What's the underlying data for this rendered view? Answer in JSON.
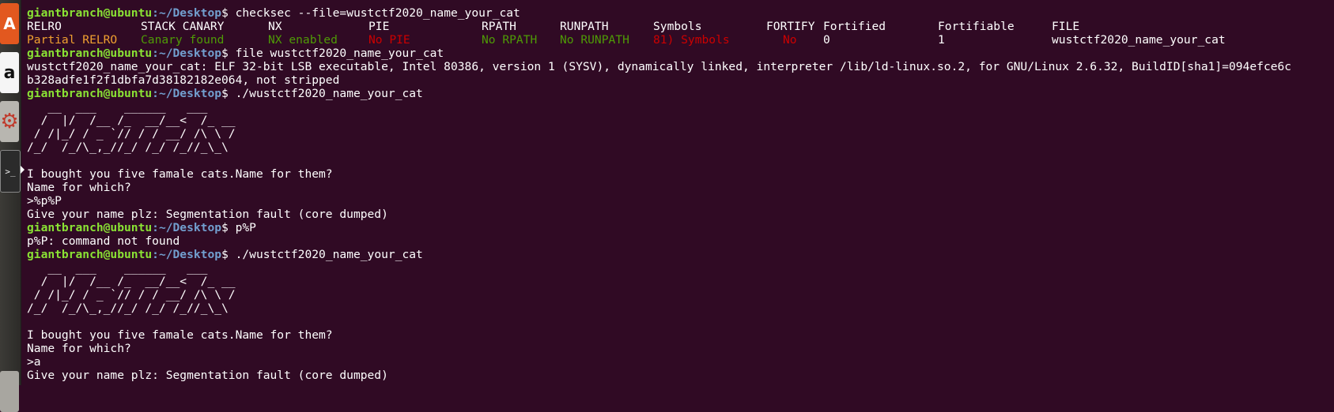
{
  "launcher": {
    "items": [
      {
        "name": "ubuntu-software",
        "icon": "shopping-bag-icon",
        "glyph": "A"
      },
      {
        "name": "amazon",
        "icon": "amazon-icon",
        "glyph": "a"
      },
      {
        "name": "system-settings",
        "icon": "gear-icon",
        "glyph": "⚙"
      },
      {
        "name": "terminal",
        "icon": "terminal-icon",
        "glyph": ">_"
      },
      {
        "name": "trash",
        "icon": "trash-icon",
        "glyph": ""
      }
    ]
  },
  "prompt": {
    "user_host": "giantbranch@ubuntu",
    "path": ":~/Desktop",
    "dollar": "$ "
  },
  "checksec": {
    "command": "checksec --file=wustctf2020_name_your_cat",
    "headers": [
      "RELRO",
      "STACK CANARY",
      "NX",
      "PIE",
      "RPATH",
      "RUNPATH",
      "Symbols",
      "FORTIFY",
      "Fortified",
      "Fortifiable",
      "FILE"
    ],
    "values": [
      "Partial RELRO",
      "Canary found",
      "NX enabled",
      "No PIE",
      "No RPATH",
      "No RUNPATH",
      "81) Symbols",
      "No",
      "0",
      "1",
      "wustctf2020_name_your_cat"
    ]
  },
  "file_cmd": {
    "command": "file wustctf2020_name_your_cat",
    "output_1": "wustctf2020_name_your_cat: ELF 32-bit LSB executable, Intel 80386, version 1 (SYSV), dynamically linked, interpreter /lib/ld-linux.so.2, for GNU/Linux 2.6.32, BuildID[sha1]=094efce6c",
    "output_2": "b328adfe1f2f1dbfa7d38182182e064, not stripped"
  },
  "run1": {
    "command": "./wustctf2020_name_your_cat",
    "banner": [
      "   __  ___    ______   ___",
      "  /  |/  /__ /_  __/__<  /_ __",
      " / /|_/ / _ `// / / __/ /\\ \\ /",
      "/_/  /_/\\_,_//_/ /_/ /_//_\\_\\"
    ],
    "blank": "",
    "msg1": "I bought you five famale cats.Name for them?",
    "msg2": "Name for which?",
    "input": ">%p%P",
    "msg3": "Give your name plz: Segmentation fault (core dumped)"
  },
  "cmd_p": {
    "command": "p%P",
    "output": "p%P: command not found"
  },
  "run2": {
    "command": "./wustctf2020_name_your_cat",
    "banner": [
      "   __  ___    ______   ___",
      "  /  |/  /__ /_  __/__<  /_ __",
      " / /|_/ / _ `// / / __/ /\\ \\ /",
      "/_/  /_/\\_,_//_/ /_/ /_//_\\_\\"
    ],
    "blank": "",
    "msg1": "I bought you five famale cats.Name for them?",
    "msg2": "Name for which?",
    "input": ">a",
    "msg3": "Give your name plz: Segmentation fault (core dumped)"
  }
}
